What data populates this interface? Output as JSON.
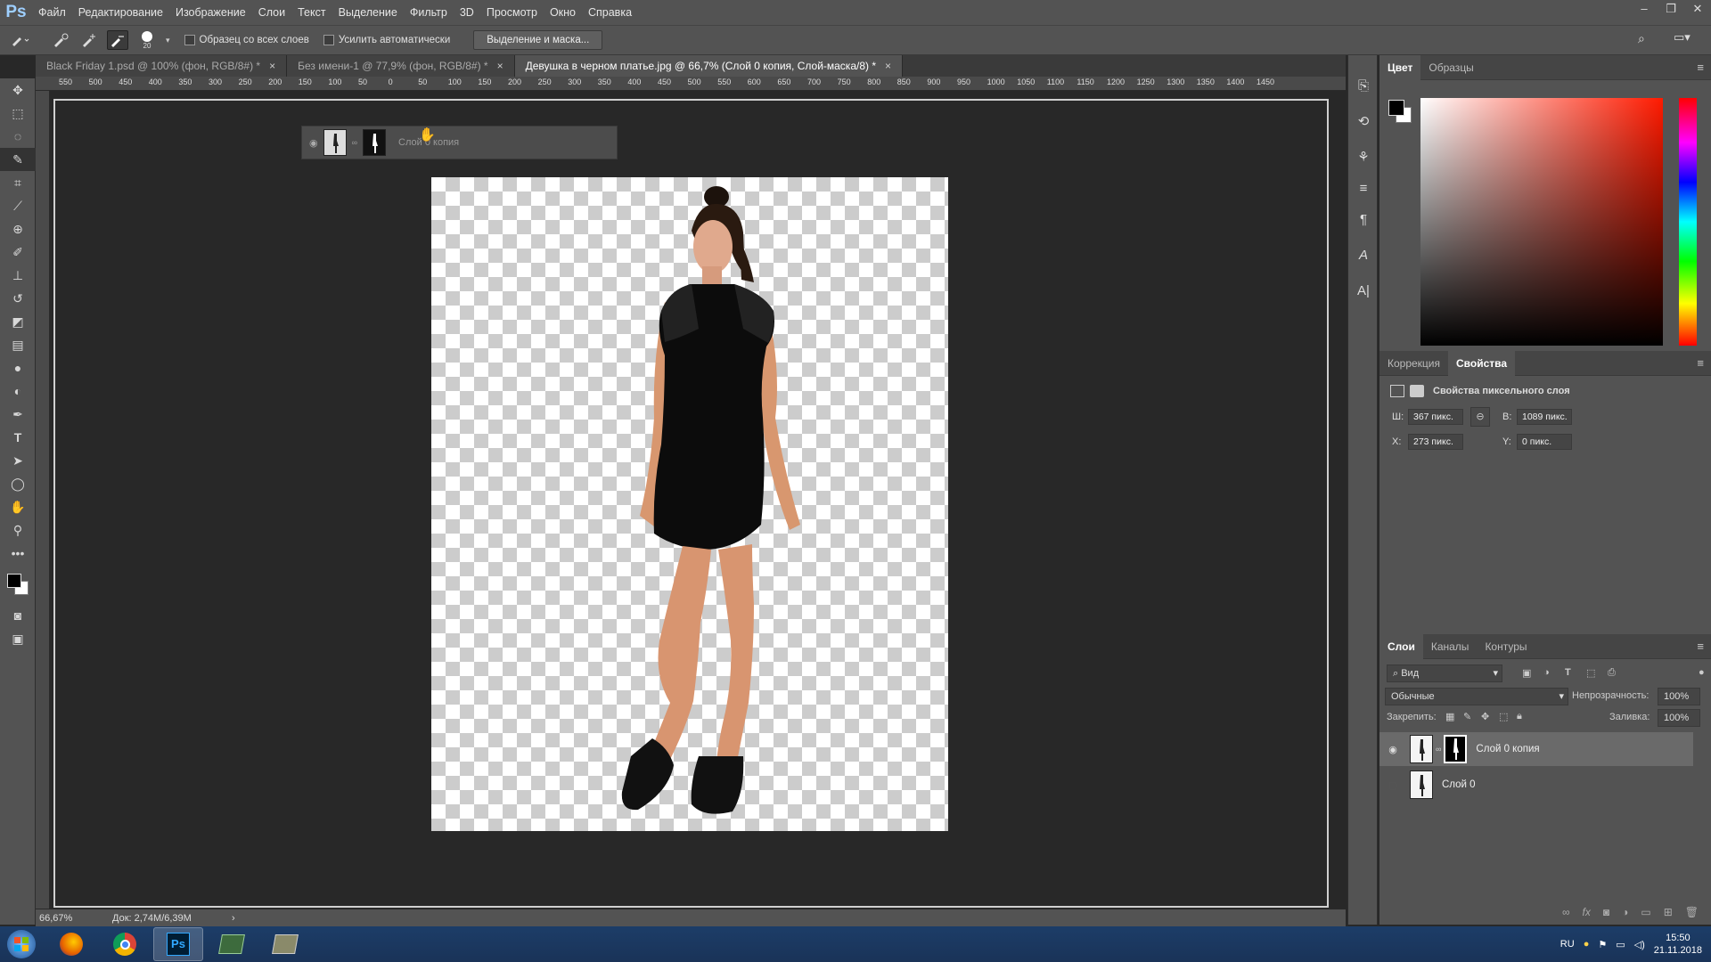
{
  "app": {
    "logo": "Ps"
  },
  "menu": [
    "Файл",
    "Редактирование",
    "Изображение",
    "Слои",
    "Текст",
    "Выделение",
    "Фильтр",
    "3D",
    "Просмотр",
    "Окно",
    "Справка"
  ],
  "window_controls": {
    "minimize": "–",
    "restore": "❐",
    "close": "✕"
  },
  "options": {
    "brush_size": "20",
    "sample_all_layers": "Образец со всех слоев",
    "auto_enhance": "Усилить автоматически",
    "select_mask": "Выделение и маска..."
  },
  "tabs": [
    {
      "label": "Black Friday 1.psd @ 100% (фон, RGB/8#) *",
      "close": "×"
    },
    {
      "label": "Без имени-1 @ 77,9% (фон, RGB/8#) *",
      "close": "×"
    },
    {
      "label": "Девушка в черном платье.jpg @ 66,7% (Слой 0 копия, Слой-маска/8) *",
      "close": "×",
      "active": true
    }
  ],
  "ruler_labels": [
    "550",
    "500",
    "450",
    "400",
    "350",
    "300",
    "250",
    "200",
    "150",
    "100",
    "50",
    "0",
    "50",
    "100",
    "150",
    "200",
    "250",
    "300",
    "350",
    "400",
    "450",
    "500",
    "550",
    "600",
    "650",
    "700",
    "750",
    "800",
    "850",
    "900",
    "950",
    "1000",
    "1050",
    "1100",
    "1150",
    "1200",
    "1250",
    "1300",
    "1350",
    "1400",
    "1450"
  ],
  "drag_layer": {
    "label": "Слой 0 копия"
  },
  "status": {
    "zoom": "66,67%",
    "doc": "Док: 2,74M/6,39M",
    "arrow": "›"
  },
  "color_panel": {
    "tabs": [
      "Цвет",
      "Образцы"
    ],
    "fg": "#000000",
    "bg": "#ffffff"
  },
  "properties_panel": {
    "tabs": [
      "Коррекция",
      "Свойства"
    ],
    "title": "Свойства пиксельного слоя",
    "w_label": "Ш:",
    "w_value": "367 пикс.",
    "h_label": "В:",
    "h_value": "1089 пикс.",
    "x_label": "X:",
    "x_value": "273 пикс.",
    "y_label": "Y:",
    "y_value": "0 пикс."
  },
  "layers_panel": {
    "tabs": [
      "Слои",
      "Каналы",
      "Контуры"
    ],
    "filter": "Вид",
    "blend": "Обычные",
    "opacity_label": "Непрозрачность:",
    "opacity_value": "100%",
    "lock_label": "Закрепить:",
    "fill_label": "Заливка:",
    "fill_value": "100%",
    "layers": [
      {
        "name": "Слой 0 копия",
        "selected": true,
        "visible": true
      },
      {
        "name": "Слой 0",
        "selected": false,
        "visible": false
      }
    ]
  },
  "taskbar": {
    "lang": "RU",
    "time": "15:50",
    "date": "21.11.2018"
  }
}
